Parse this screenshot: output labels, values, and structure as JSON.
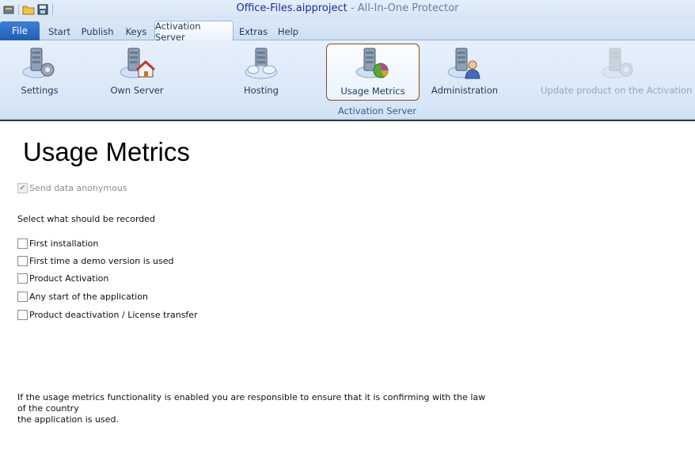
{
  "window": {
    "project": "Office-Files.aipproject",
    "app": " - All-In-One Protector"
  },
  "tabs": [
    {
      "label": "File"
    },
    {
      "label": "Start"
    },
    {
      "label": "Publish"
    },
    {
      "label": "Keys"
    },
    {
      "label": "Activation Server"
    },
    {
      "label": "Extras"
    },
    {
      "label": "Help"
    }
  ],
  "active_tab": "Activation Server",
  "ribbon": {
    "group_label": "Activation Server",
    "buttons": [
      {
        "label": "Settings",
        "icon": "server-gear-icon"
      },
      {
        "label": "Own Server",
        "icon": "server-home-icon"
      },
      {
        "label": "Hosting",
        "icon": "server-cloud-icon"
      },
      {
        "label": "Usage Metrics",
        "icon": "server-pie-chart-icon",
        "selected": true
      },
      {
        "label": "Administration",
        "icon": "server-user-icon"
      },
      {
        "label": "Update product on the Activation Server",
        "icon": "server-update-icon",
        "disabled": true
      }
    ]
  },
  "page": {
    "title": "Usage Metrics",
    "anonymous_label": "Send data anonymous",
    "anonymous_checked": true,
    "select_label": "Select what should be recorded",
    "options": [
      {
        "label": "First installation",
        "checked": false
      },
      {
        "label": "First time a demo version is used",
        "checked": false
      },
      {
        "label": "Product Activation",
        "checked": false
      },
      {
        "label": "Any start of the application",
        "checked": false
      },
      {
        "label": "Product deactivation / License transfer",
        "checked": false
      }
    ],
    "note_line1": "If the usage metrics functionality is enabled you are responsible to ensure that it is confirming with the law of the country",
    "note_line2": "the application is used."
  },
  "colors": {
    "file_tab": "#2a6cc6",
    "selected_border": "#8b4a1f",
    "title_project": "#1a2d9e"
  }
}
